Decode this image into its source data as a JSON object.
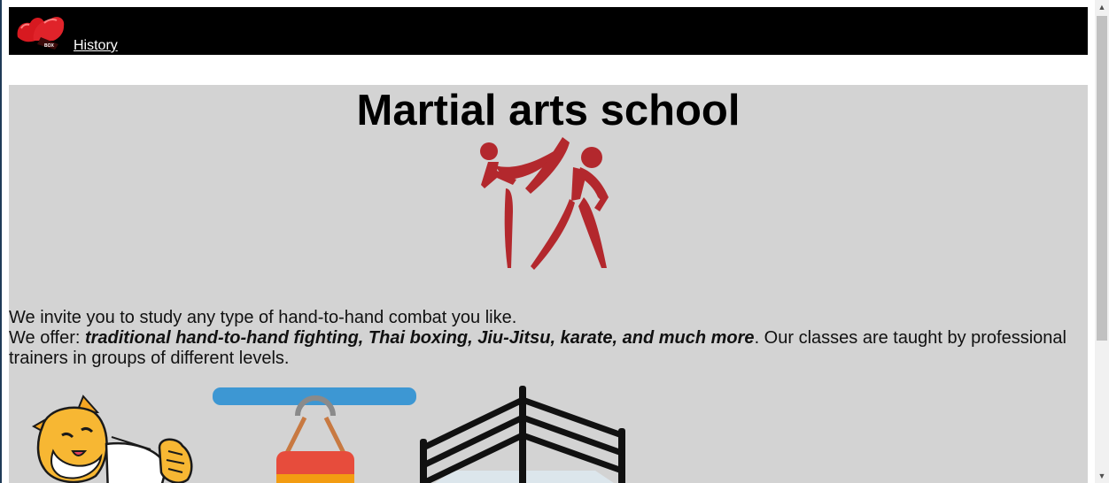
{
  "nav": {
    "logo_icon": "boxing-glove-icon",
    "links": [
      {
        "label": "History"
      }
    ]
  },
  "main": {
    "title": "Martial arts school",
    "hero_icon": "martial-arts-kick-icon",
    "intro_line1": "We invite you to study any type of hand-to-hand combat you like.",
    "offer_prefix": "We offer: ",
    "offer_list": "traditional hand-to-hand fighting, Thai boxing, Jiu-Jitsu, karate, and much more",
    "offer_suffix": ". Our classes are taught by professional trainers in groups of different levels.",
    "images": [
      {
        "icon": "cartoon-cat-fighter-icon"
      },
      {
        "icon": "punching-bag-icon"
      },
      {
        "icon": "boxing-ring-icon"
      }
    ]
  },
  "colors": {
    "nav_bg": "#000000",
    "main_bg": "#d3d3d3",
    "accent_red": "#b3282d",
    "link": "#ffffff"
  }
}
